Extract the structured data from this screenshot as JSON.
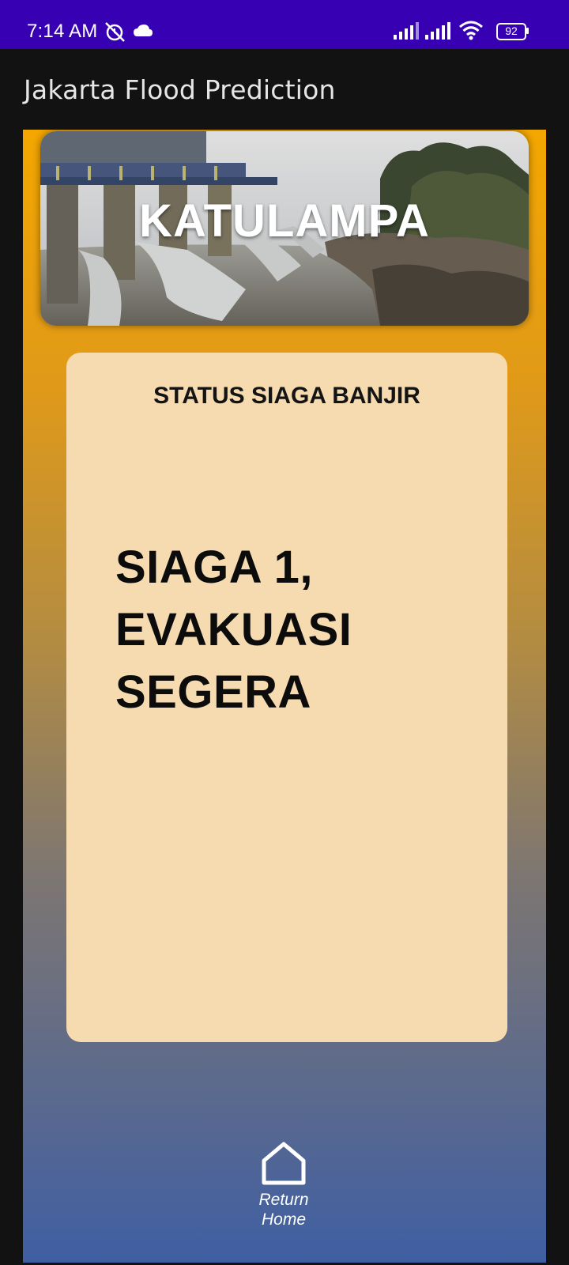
{
  "status_bar": {
    "time": "7:14 AM",
    "battery": "92",
    "icons": [
      "alarm-off-icon",
      "cloud-icon",
      "signal-icon",
      "signal-icon",
      "wifi-icon",
      "battery-icon"
    ]
  },
  "app_bar": {
    "title": "Jakarta Flood Prediction"
  },
  "banner": {
    "title": "KATULAMPA"
  },
  "status_card": {
    "heading": "STATUS SIAGA BANJIR",
    "status_lines": [
      "SIAGA 1,",
      "EVAKUASI",
      "SEGERA"
    ]
  },
  "home_button": {
    "icon": "home-icon",
    "label_line1": "Return",
    "label_line2": "Home"
  },
  "colors": {
    "status_bar": "#3700b3",
    "app_bar": "#121212",
    "gradient_top": "#f4a700",
    "gradient_bottom": "#3f5fa3",
    "card": "#f5dbaf"
  }
}
